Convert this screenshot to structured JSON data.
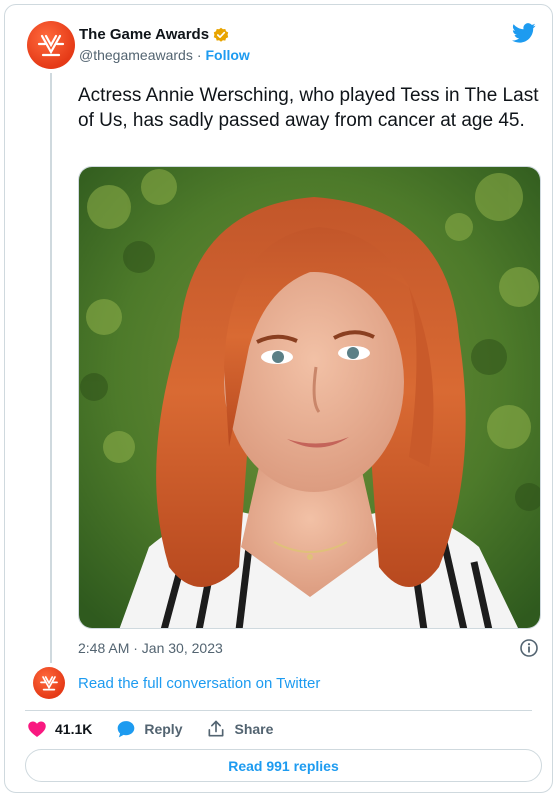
{
  "account": {
    "name": "The Game Awards",
    "handle": "@thegameawards",
    "separator": "·",
    "follow_label": "Follow"
  },
  "tweet": {
    "text": "Actress Annie Wersching, who played Tess in The Last of Us, has sadly passed away from cancer at age 45.",
    "timestamp": "2:48 AM · Jan 30, 2023"
  },
  "conversation": {
    "link_label": "Read the full conversation on Twitter"
  },
  "actions": {
    "like_count": "41.1K",
    "reply_label": "Reply",
    "share_label": "Share"
  },
  "replies_button": {
    "label": "Read 991 replies"
  },
  "colors": {
    "accent": "#1d9bf0",
    "like": "#f91880",
    "brand": "#e53a17",
    "verified": "#e8a400"
  },
  "icons": [
    "tga-logo-icon",
    "verified-badge-icon",
    "twitter-bird-icon",
    "info-icon",
    "heart-icon",
    "reply-bubble-icon",
    "share-icon"
  ]
}
